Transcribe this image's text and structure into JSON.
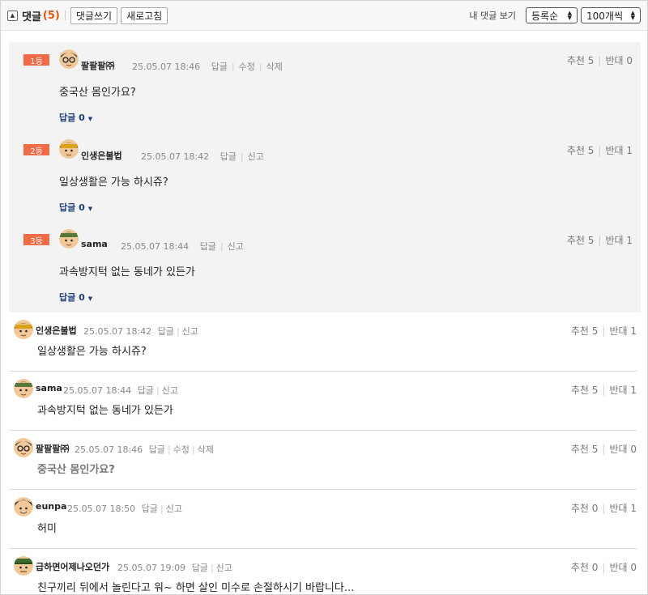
{
  "toolbar": {
    "title": "댓글",
    "count": "(5)",
    "write_label": "댓글쓰기",
    "refresh_label": "새로고침",
    "my_comments_label": "내 댓글 보기",
    "sort_value": "등록순",
    "page_size_value": "100개씩"
  },
  "best_comments": [
    {
      "rank": "1등",
      "nick": "팔팔팔㈜",
      "time": "25.05.07 18:46",
      "actions": [
        "답글",
        "수정",
        "삭제"
      ],
      "text": "중국산 몸인가요?",
      "recommend": "추천 5",
      "oppose": "반대 0",
      "reply": "답글 0"
    },
    {
      "rank": "2등",
      "nick": "인생은불법",
      "time": "25.05.07 18:42",
      "actions": [
        "답글",
        "신고"
      ],
      "text": "일상생활은 가능 하시쥬?",
      "recommend": "추천 5",
      "oppose": "반대 1",
      "reply": "답글 0"
    },
    {
      "rank": "3등",
      "nick": "sama",
      "time": "25.05.07 18:44",
      "actions": [
        "답글",
        "신고"
      ],
      "text": "과속방지턱 없는 동네가 있든가",
      "recommend": "추천 5",
      "oppose": "반대 1",
      "reply": "답글 0"
    }
  ],
  "comments": [
    {
      "nick": "인생은불법",
      "time": "25.05.07 18:42",
      "actions": [
        "답글",
        "신고"
      ],
      "text": "일상생활은 가능 하시쥬?",
      "recommend": "추천 5",
      "oppose": "반대 1"
    },
    {
      "nick": "sama",
      "time": "25.05.07 18:44",
      "actions": [
        "답글",
        "신고"
      ],
      "text": "과속방지턱 없는 동네가 있든가",
      "recommend": "추천 5",
      "oppose": "반대 1"
    },
    {
      "nick": "팔팔팔㈜",
      "time": "25.05.07 18:46",
      "actions": [
        "답글",
        "수정",
        "삭제"
      ],
      "text": "중국산 몸인가요?",
      "recommend": "추천 5",
      "oppose": "반대 0"
    },
    {
      "nick": "eunpa",
      "time": "25.05.07 18:50",
      "actions": [
        "답글",
        "신고"
      ],
      "text": "허미",
      "recommend": "추천 0",
      "oppose": "반대 1"
    },
    {
      "nick": "급하면어제나오던가",
      "time": "25.05.07 19:09",
      "actions": [
        "답글",
        "신고"
      ],
      "text": "친구끼리 뒤에서 놀린다고 워~ 하면 살인 미수로 손절하시기 바랍니다...",
      "recommend": "추천 0",
      "oppose": "반대 0"
    }
  ],
  "colors": {
    "accent": "#e8560c",
    "rank_badge": "#f26b47",
    "reply_link": "#1d3f7a"
  },
  "icons": {
    "toggle": "collapse-up-icon",
    "avatar": "avatar-icon",
    "caret": "caret-down-icon"
  }
}
